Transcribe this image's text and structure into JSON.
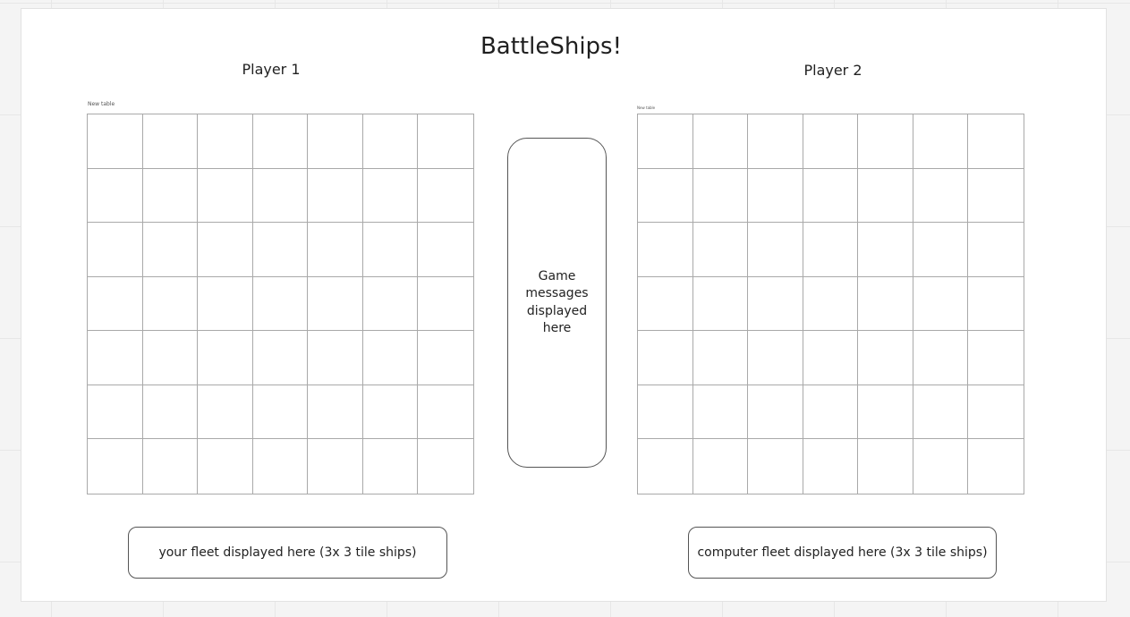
{
  "title": "BattleShips!",
  "players": {
    "p1": {
      "label": "Player 1",
      "table_caption": "New table"
    },
    "p2": {
      "label": "Player 2",
      "table_caption": "New table"
    }
  },
  "grid": {
    "rows": 7,
    "cols": 7
  },
  "messages": {
    "text": "Game messages displayed here"
  },
  "fleets": {
    "left": "your fleet displayed here (3x 3 tile ships)",
    "right": "computer fleet displayed here (3x 3 tile ships)"
  },
  "colors": {
    "grid_line": "#a9a9a9",
    "box_border": "#555555",
    "frame_bg": "#ffffff",
    "canvas_bg": "#f4f4f4"
  }
}
